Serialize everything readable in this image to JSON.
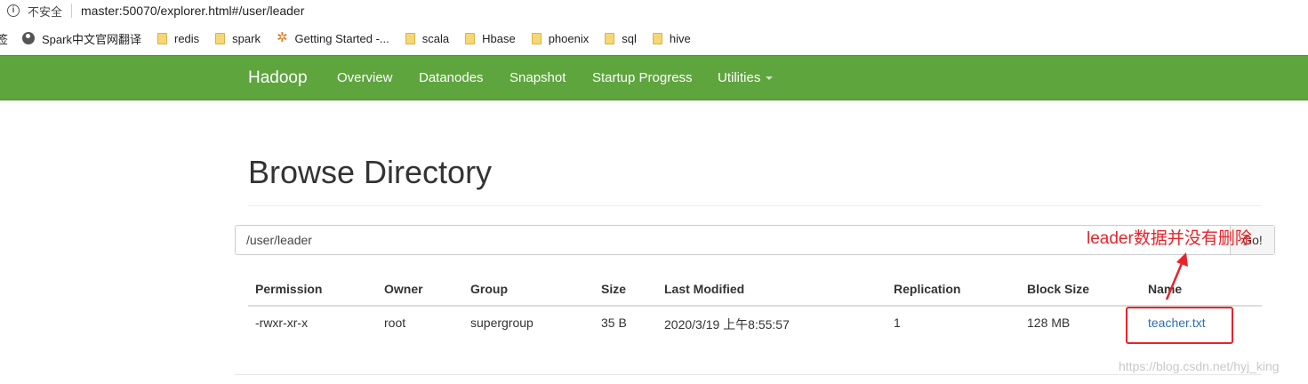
{
  "browser": {
    "security_label": "不安全",
    "url": "master:50070/explorer.html#/user/leader",
    "bookmarks": [
      {
        "label": "签",
        "icon": "folder-icon"
      },
      {
        "label": "Spark中文官网翻译",
        "icon": "globe-icon"
      },
      {
        "label": "redis",
        "icon": "folder-icon"
      },
      {
        "label": "spark",
        "icon": "folder-icon"
      },
      {
        "label": "Getting Started -...",
        "icon": "star-icon"
      },
      {
        "label": "scala",
        "icon": "folder-icon"
      },
      {
        "label": "Hbase",
        "icon": "folder-icon"
      },
      {
        "label": "phoenix",
        "icon": "folder-icon"
      },
      {
        "label": "sql",
        "icon": "folder-icon"
      },
      {
        "label": "hive",
        "icon": "folder-icon"
      }
    ]
  },
  "navbar": {
    "brand": "Hadoop",
    "links": [
      "Overview",
      "Datanodes",
      "Snapshot",
      "Startup Progress",
      "Utilities"
    ],
    "color": "#5ea53e"
  },
  "page": {
    "title": "Browse Directory",
    "path_value": "/user/leader",
    "go_label": "Go!"
  },
  "table": {
    "headers": [
      "Permission",
      "Owner",
      "Group",
      "Size",
      "Last Modified",
      "Replication",
      "Block Size",
      "Name"
    ],
    "rows": [
      [
        "-rwxr-xr-x",
        "root",
        "supergroup",
        "35 B",
        "2020/3/19 上午8:55:57",
        "1",
        "128 MB",
        "teacher.txt"
      ]
    ]
  },
  "annotation": {
    "text": "leader数据并没有删除",
    "color": "#e8232a"
  },
  "watermark": "https://blog.csdn.net/hyj_king"
}
